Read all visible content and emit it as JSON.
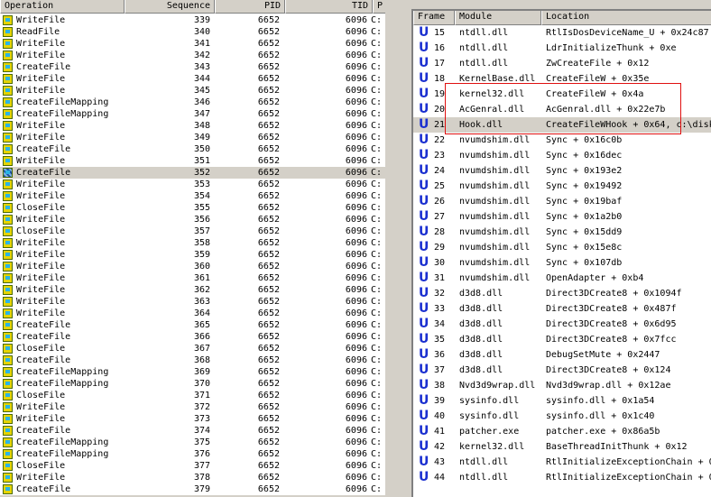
{
  "left": {
    "headers": [
      "Operation",
      "Sequence",
      "PID",
      "TID",
      "P"
    ],
    "rows": [
      [
        "WriteFile",
        "339"
      ],
      [
        "ReadFile",
        "340"
      ],
      [
        "WriteFile",
        "341"
      ],
      [
        "WriteFile",
        "342"
      ],
      [
        "CreateFile",
        "343"
      ],
      [
        "WriteFile",
        "344"
      ],
      [
        "WriteFile",
        "345"
      ],
      [
        "CreateFileMapping",
        "346"
      ],
      [
        "CreateFileMapping",
        "347"
      ],
      [
        "WriteFile",
        "348"
      ],
      [
        "WriteFile",
        "349"
      ],
      [
        "CreateFile",
        "350"
      ],
      [
        "WriteFile",
        "351"
      ],
      [
        "CreateFile",
        "352"
      ],
      [
        "WriteFile",
        "353"
      ],
      [
        "WriteFile",
        "354"
      ],
      [
        "CloseFile",
        "355"
      ],
      [
        "WriteFile",
        "356"
      ],
      [
        "CloseFile",
        "357"
      ],
      [
        "WriteFile",
        "358"
      ],
      [
        "WriteFile",
        "359"
      ],
      [
        "WriteFile",
        "360"
      ],
      [
        "WriteFile",
        "361"
      ],
      [
        "WriteFile",
        "362"
      ],
      [
        "WriteFile",
        "363"
      ],
      [
        "WriteFile",
        "364"
      ],
      [
        "CreateFile",
        "365"
      ],
      [
        "CreateFile",
        "366"
      ],
      [
        "CloseFile",
        "367"
      ],
      [
        "CreateFile",
        "368"
      ],
      [
        "CreateFileMapping",
        "369"
      ],
      [
        "CreateFileMapping",
        "370"
      ],
      [
        "CloseFile",
        "371"
      ],
      [
        "WriteFile",
        "372"
      ],
      [
        "WriteFile",
        "373"
      ],
      [
        "CreateFile",
        "374"
      ],
      [
        "CreateFileMapping",
        "375"
      ],
      [
        "CreateFileMapping",
        "376"
      ],
      [
        "CloseFile",
        "377"
      ],
      [
        "WriteFile",
        "378"
      ],
      [
        "CreateFile",
        "379"
      ]
    ],
    "pid": "6652",
    "tid": "6096",
    "path_prefix": "C:",
    "selected_sequence": "352"
  },
  "right": {
    "headers": [
      "Frame",
      "Module",
      "Location"
    ],
    "frame_icon": "U",
    "selected_frame": "21",
    "rows": [
      [
        "15",
        "ntdll.dll",
        "RtlIsDosDeviceName_U + 0x24c87"
      ],
      [
        "16",
        "ntdll.dll",
        "LdrInitializeThunk + 0xe"
      ],
      [
        "17",
        "ntdll.dll",
        "ZwCreateFile + 0x12"
      ],
      [
        "18",
        "KernelBase.dll",
        "CreateFileW + 0x35e"
      ],
      [
        "19",
        "kernel32.dll",
        "CreateFileW + 0x4a"
      ],
      [
        "20",
        "AcGenral.dll",
        "AcGenral.dll + 0x22e7b"
      ],
      [
        "21",
        "Hook.dll",
        "CreateFileWHook + 0x64, c:\\disk"
      ],
      [
        "22",
        "nvumdshim.dll",
        "Sync + 0x16c0b"
      ],
      [
        "23",
        "nvumdshim.dll",
        "Sync + 0x16dec"
      ],
      [
        "24",
        "nvumdshim.dll",
        "Sync + 0x193e2"
      ],
      [
        "25",
        "nvumdshim.dll",
        "Sync + 0x19492"
      ],
      [
        "26",
        "nvumdshim.dll",
        "Sync + 0x19baf"
      ],
      [
        "27",
        "nvumdshim.dll",
        "Sync + 0x1a2b0"
      ],
      [
        "28",
        "nvumdshim.dll",
        "Sync + 0x15dd9"
      ],
      [
        "29",
        "nvumdshim.dll",
        "Sync + 0x15e8c"
      ],
      [
        "30",
        "nvumdshim.dll",
        "Sync + 0x107db"
      ],
      [
        "31",
        "nvumdshim.dll",
        "OpenAdapter + 0xb4"
      ],
      [
        "32",
        "d3d8.dll",
        "Direct3DCreate8 + 0x1094f"
      ],
      [
        "33",
        "d3d8.dll",
        "Direct3DCreate8 + 0x487f"
      ],
      [
        "34",
        "d3d8.dll",
        "Direct3DCreate8 + 0x6d95"
      ],
      [
        "35",
        "d3d8.dll",
        "Direct3DCreate8 + 0x7fcc"
      ],
      [
        "36",
        "d3d8.dll",
        "DebugSetMute + 0x2447"
      ],
      [
        "37",
        "d3d8.dll",
        "Direct3DCreate8 + 0x124"
      ],
      [
        "38",
        "Nvd3d9wrap.dll",
        "Nvd3d9wrap.dll + 0x12ae"
      ],
      [
        "39",
        "sysinfo.dll",
        "sysinfo.dll + 0x1a54"
      ],
      [
        "40",
        "sysinfo.dll",
        "sysinfo.dll + 0x1c40"
      ],
      [
        "41",
        "patcher.exe",
        "patcher.exe + 0x86a5b"
      ],
      [
        "42",
        "kernel32.dll",
        "BaseThreadInitThunk + 0x12"
      ],
      [
        "43",
        "ntdll.dll",
        "RtlInitializeExceptionChain + 0"
      ],
      [
        "44",
        "ntdll.dll",
        "RtlInitializeExceptionChain + 0"
      ]
    ]
  }
}
